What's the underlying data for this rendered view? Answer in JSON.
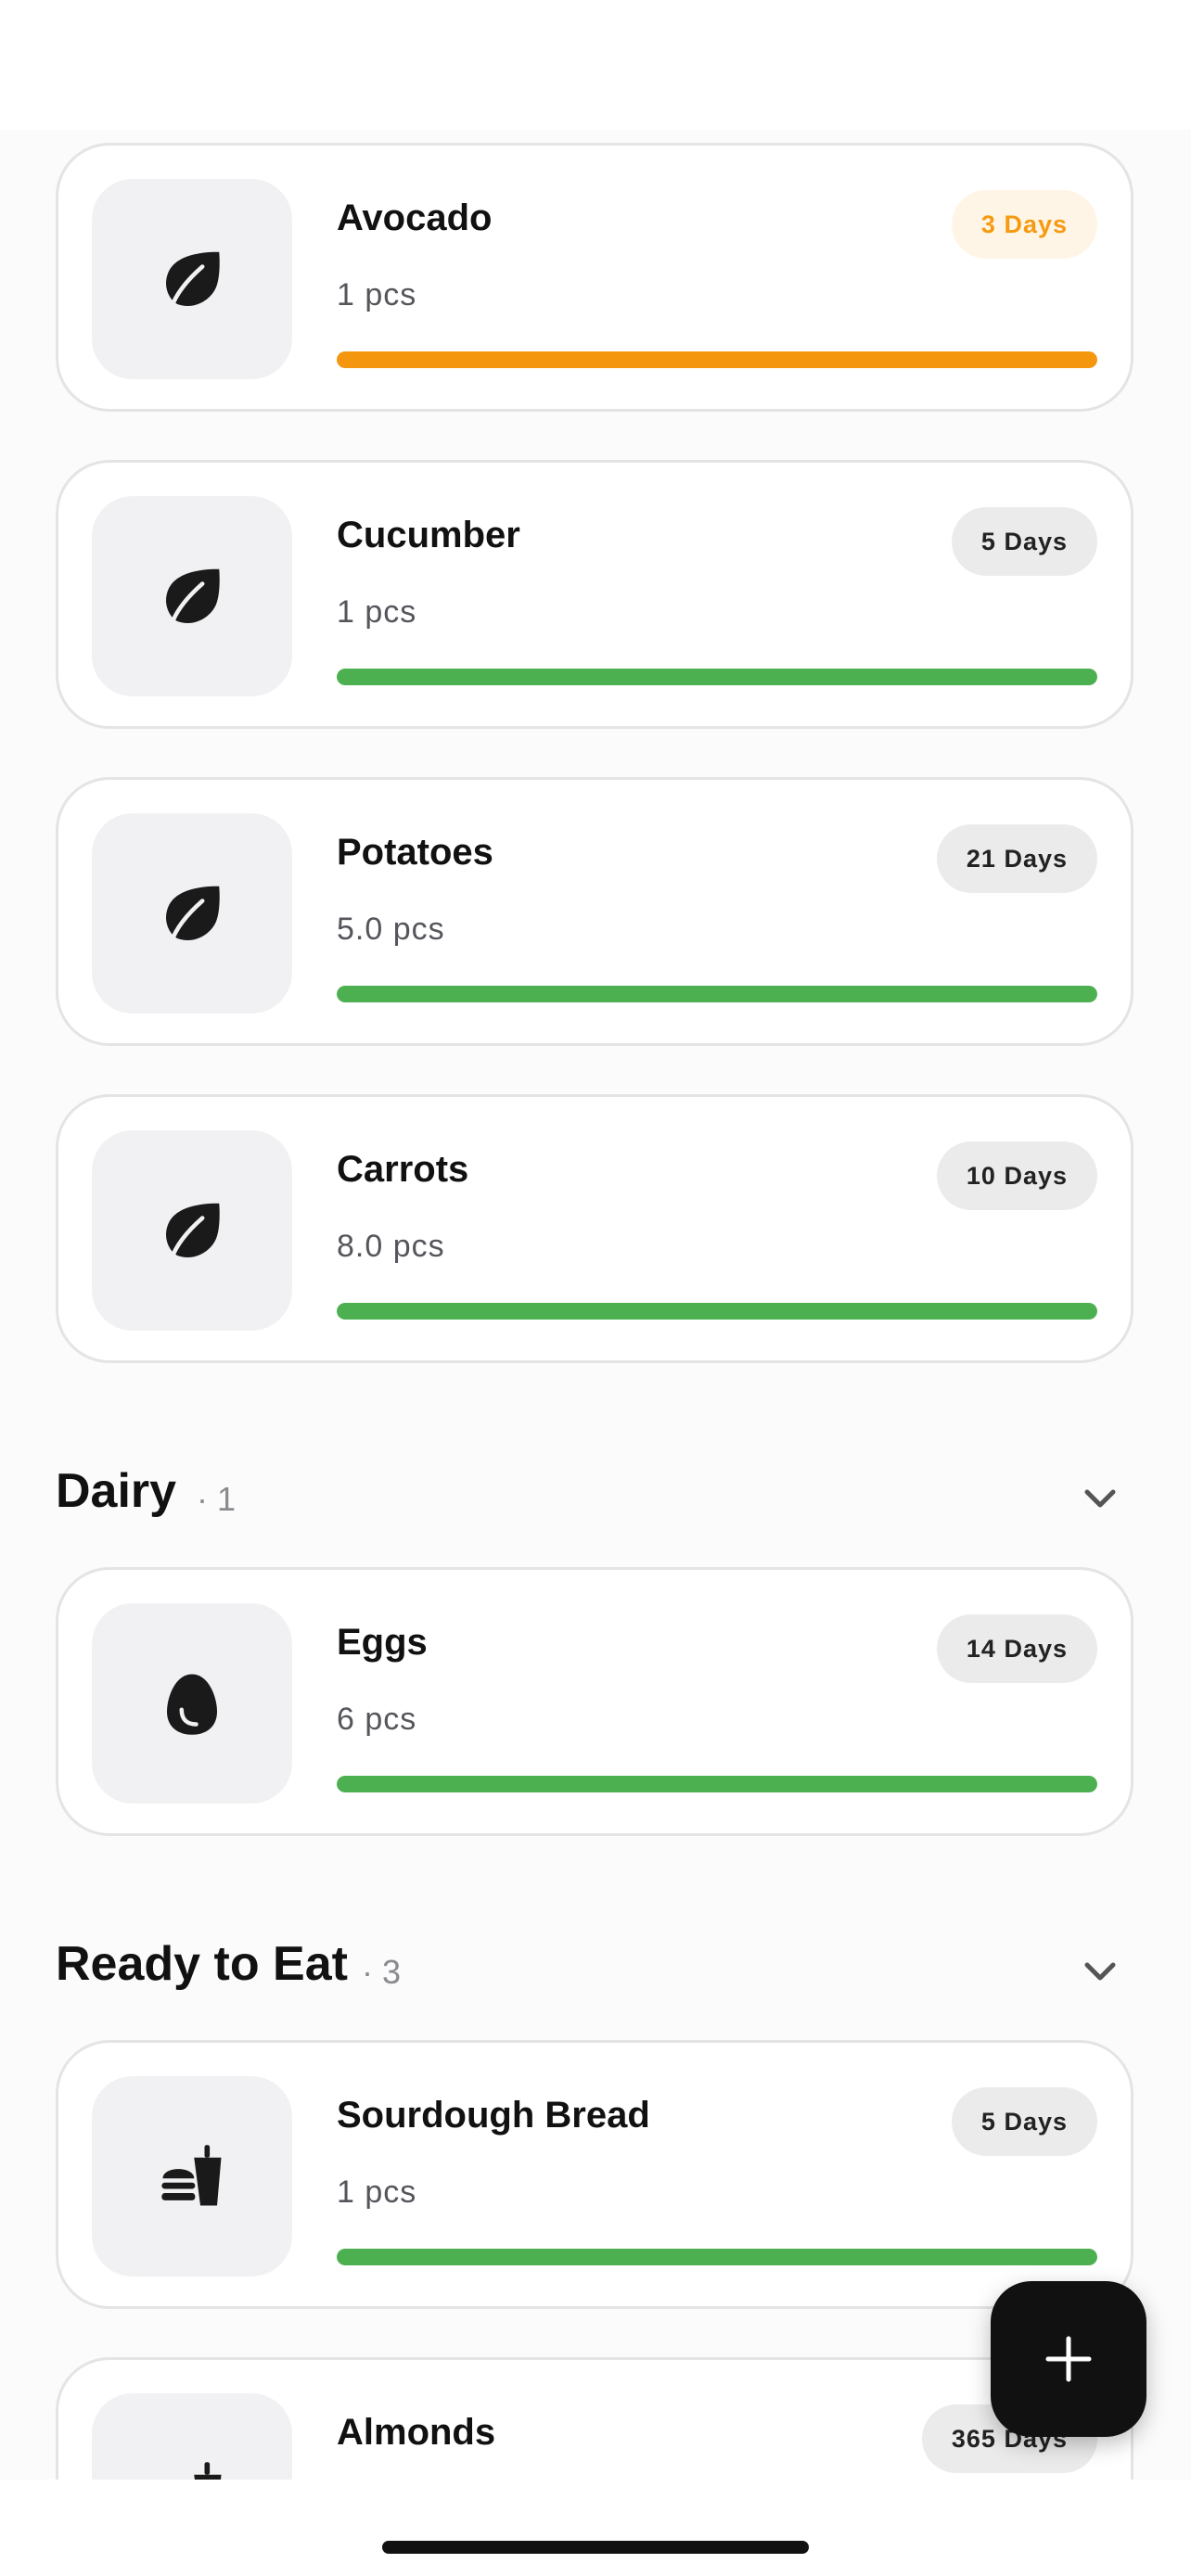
{
  "sections": {
    "vegetables": {
      "items": [
        {
          "name": "Avocado",
          "quantity": "1 pcs",
          "days_left": "3 Days",
          "status": "warning",
          "freshness_percent": 100,
          "icon": "leaf-icon"
        },
        {
          "name": "Cucumber",
          "quantity": "1 pcs",
          "days_left": "5 Days",
          "status": "fresh",
          "freshness_percent": 100,
          "icon": "leaf-icon"
        },
        {
          "name": "Potatoes",
          "quantity": "5.0 pcs",
          "days_left": "21 Days",
          "status": "fresh",
          "freshness_percent": 100,
          "icon": "leaf-icon"
        },
        {
          "name": "Carrots",
          "quantity": "8.0 pcs",
          "days_left": "10 Days",
          "status": "fresh",
          "freshness_percent": 100,
          "icon": "leaf-icon"
        }
      ]
    },
    "dairy": {
      "title": "Dairy",
      "count": "· 1",
      "expanded": true,
      "items": [
        {
          "name": "Eggs",
          "quantity": "6 pcs",
          "days_left": "14 Days",
          "status": "fresh",
          "freshness_percent": 100,
          "icon": "egg-icon"
        }
      ]
    },
    "ready_to_eat": {
      "title": "Ready to Eat",
      "count": "· 3",
      "expanded": true,
      "items": [
        {
          "name": "Sourdough Bread",
          "quantity": "1 pcs",
          "days_left": "5 Days",
          "status": "fresh",
          "freshness_percent": 100,
          "icon": "food-drink-icon"
        },
        {
          "name": "Almonds",
          "days_left": "365 Days",
          "icon": "food-drink-icon"
        }
      ]
    }
  },
  "fab": {
    "icon": "plus-icon"
  },
  "colors": {
    "fresh": "#4cb050",
    "warning": "#f5960f",
    "warning_badge_bg": "#fff5e6",
    "badge_bg": "#ebebeb",
    "card_border": "#e4e4e7",
    "thumb_bg": "#f1f1f3"
  }
}
